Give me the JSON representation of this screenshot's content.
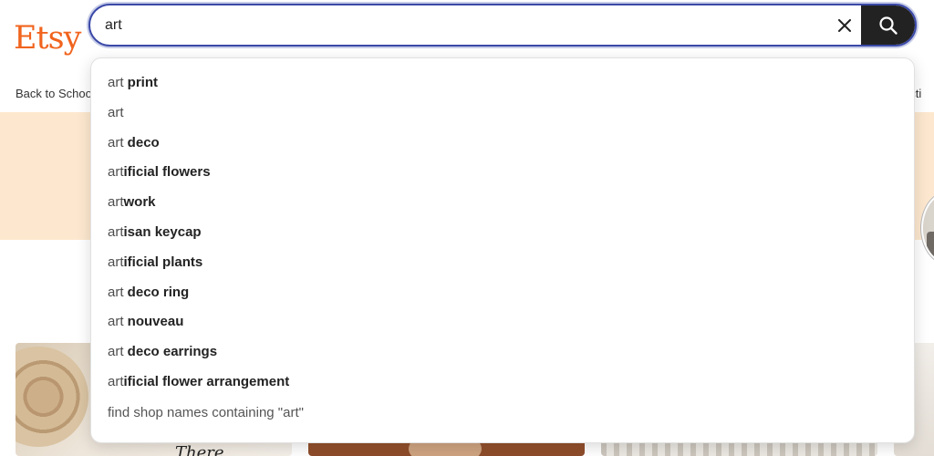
{
  "brand": {
    "logo_text": "Etsy",
    "color": "#f1641e"
  },
  "search": {
    "value": "art",
    "placeholder": "",
    "focus_color": "#3b49a8",
    "clear_icon": "close-icon",
    "submit_icon": "search-icon"
  },
  "nav": {
    "left_label": "Back to Schoo",
    "right_label": "ecti"
  },
  "suggestions": [
    {
      "typed": "art",
      "completion": " print"
    },
    {
      "typed": "art",
      "completion": ""
    },
    {
      "typed": "art",
      "completion": " deco"
    },
    {
      "typed": "art",
      "completion": "ificial flowers"
    },
    {
      "typed": "art",
      "completion": "work"
    },
    {
      "typed": "art",
      "completion": "isan keycap"
    },
    {
      "typed": "art",
      "completion": "ificial plants"
    },
    {
      "typed": "art",
      "completion": " deco ring"
    },
    {
      "typed": "art",
      "completion": " nouveau"
    },
    {
      "typed": "art",
      "completion": " deco earrings"
    },
    {
      "typed": "art",
      "completion": "ificial flower arrangement"
    }
  ],
  "shop_search": {
    "label": "find shop names containing \"art\""
  },
  "tiles": {
    "tile1_script": "There"
  },
  "colors": {
    "banner": "#fde8cf",
    "search_button": "#222222"
  }
}
